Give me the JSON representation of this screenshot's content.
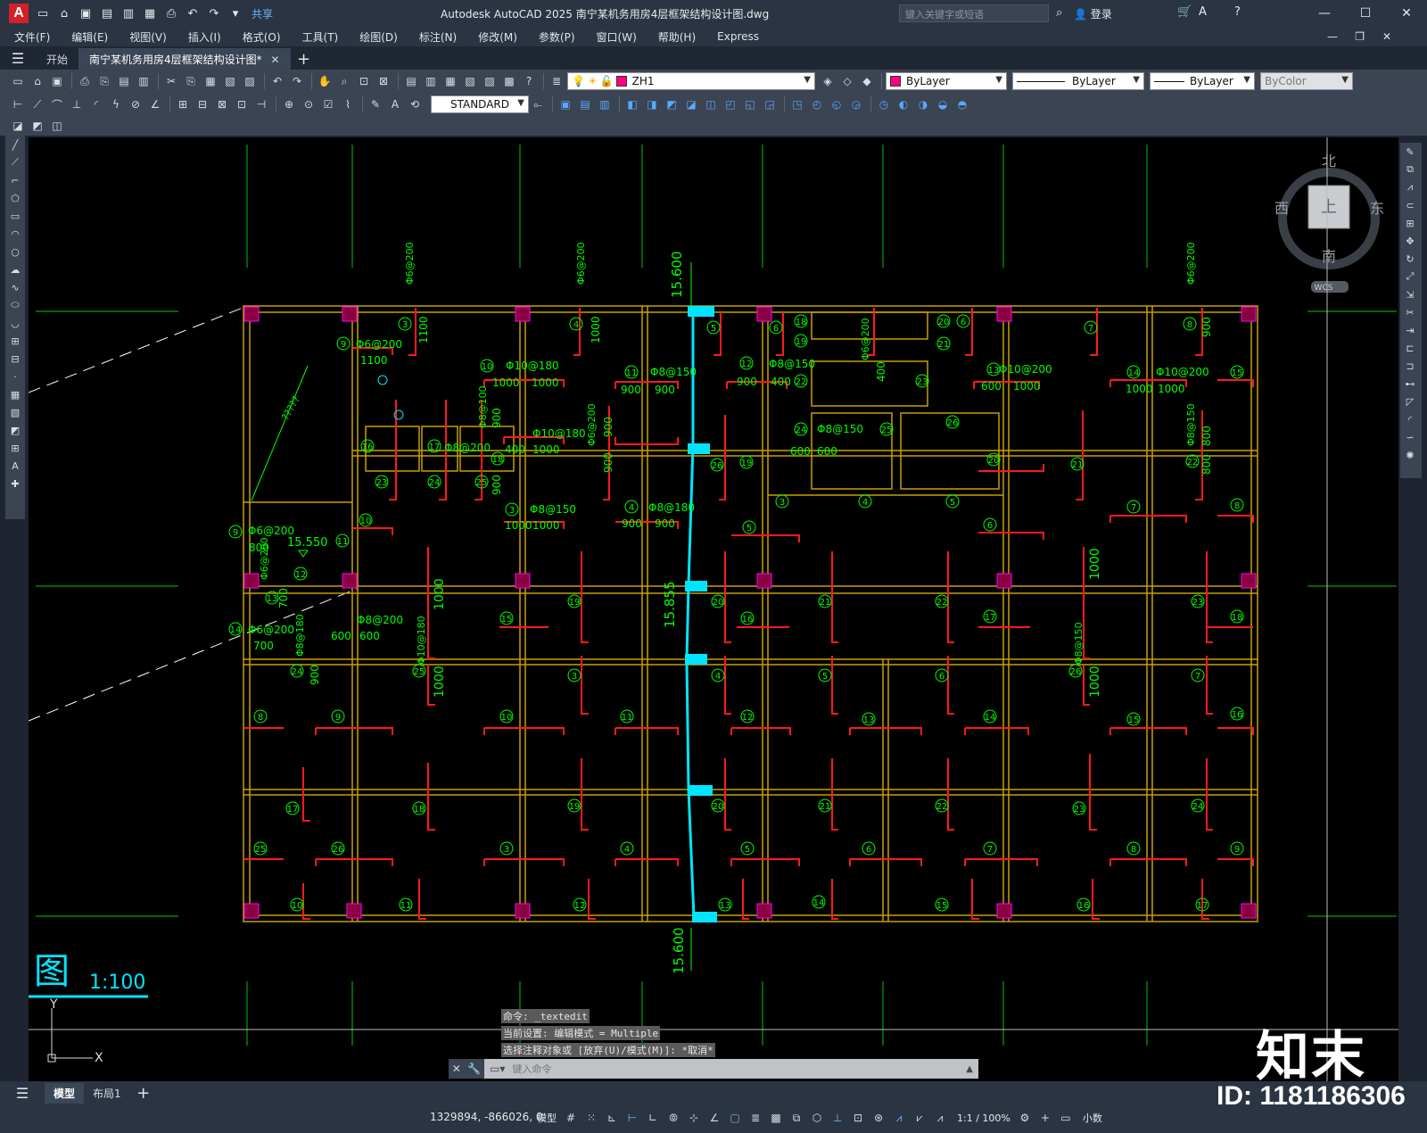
{
  "titlebar": {
    "app_logo": "A",
    "share": "共享",
    "title": "Autodesk AutoCAD 2025    南宁某机务用房4层框架结构设计图.dwg",
    "search_placeholder": "键入关键字或短语",
    "login": "登录"
  },
  "menubar": {
    "items": [
      "文件(F)",
      "编辑(E)",
      "视图(V)",
      "插入(I)",
      "格式(O)",
      "工具(T)",
      "绘图(D)",
      "标注(N)",
      "修改(M)",
      "参数(P)",
      "窗口(W)",
      "帮助(H)",
      "Express"
    ]
  },
  "tabs": {
    "start": "开始",
    "drawing": "南宁某机务用房4层框架结构设计图*"
  },
  "toolbar": {
    "layer": "ZH1",
    "color": "ByLayer",
    "linetype": "ByLayer",
    "lineweight": "ByLayer",
    "plotstyle": "ByColor",
    "textstyle": "STANDARD"
  },
  "colors": {
    "layer_swatch": "#ff0080",
    "structure": "#c8a000",
    "annotation": "#00ff00",
    "rebar": "#ff1a1a",
    "section": "#00e5ff",
    "grid": "#00c800"
  },
  "viewcube": {
    "north": "北",
    "south": "南",
    "east": "东",
    "west": "西",
    "face": "上",
    "wcs": "WCS"
  },
  "drawing": {
    "title_glyph": "图",
    "scale": "1:100",
    "elev_top": "15.600",
    "elev_mid": "15.855",
    "elev_bottom": "15.600",
    "elev_left": "15.550",
    "diag_label": "?????",
    "ucs_x": "X",
    "ucs_y": "Y"
  },
  "rebar_labels": [
    "Φ6@200",
    "Φ8@150",
    "Φ10@180",
    "Φ10@200",
    "Φ8@180",
    "Φ8@200",
    "Φ8@100"
  ],
  "dim_labels": [
    "1000",
    "1100",
    "900",
    "600",
    "400",
    "800",
    "700"
  ],
  "circle_numbers": [
    "3",
    "4",
    "5",
    "6",
    "7",
    "8",
    "9",
    "10",
    "11",
    "12",
    "13",
    "14",
    "15",
    "16",
    "17",
    "18",
    "19",
    "20",
    "21",
    "22",
    "23",
    "24",
    "25",
    "26"
  ],
  "command": {
    "line1": "命令: _textedit",
    "line2": "当前设置: 编辑模式 = Multiple",
    "line3": "选择注释对象或 [放弃(U)/模式(M)]: *取消*",
    "input_placeholder": "键入命令"
  },
  "layouts": {
    "model": "模型",
    "layout1": "布局1"
  },
  "status": {
    "coords": "1329894, -866026, 0",
    "model": "模型",
    "scale": "1:1 / 100%",
    "units": "小数"
  },
  "watermark": {
    "logo": "知末",
    "id": "ID: 1181186306"
  }
}
